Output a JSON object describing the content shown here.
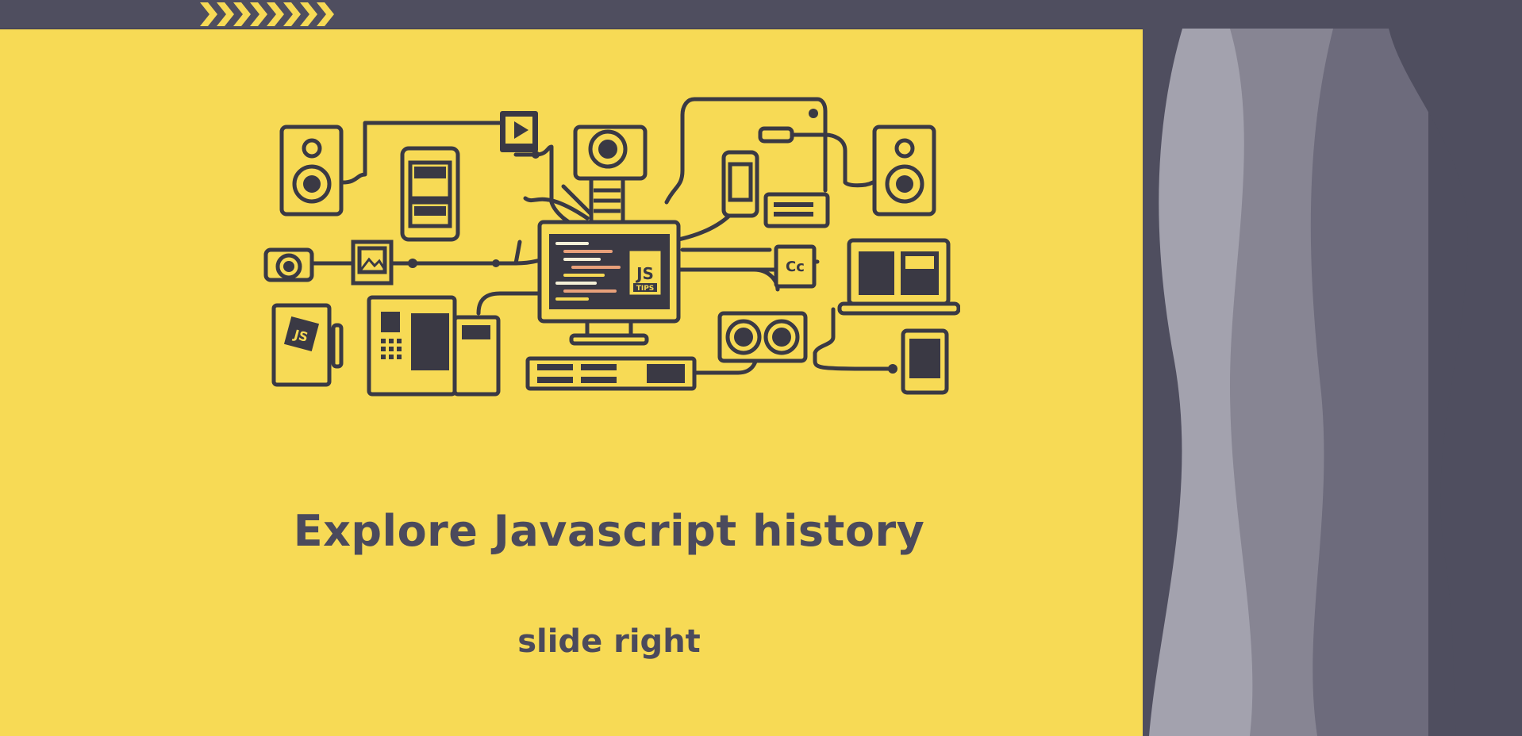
{
  "colors": {
    "background": "#f7da55",
    "ink": "#3a3944",
    "title": "#4b4a5c",
    "topbar": "#4f4e5f",
    "curtain_light": "#a3a2ae",
    "curtain_mid": "#878593",
    "curtain_dark": "#6d6b7c",
    "curtain_darkest": "#4f4e5f"
  },
  "icons": {
    "progress": "chevron-progress-icon",
    "badge": "js-tips-badge",
    "caption": "closed-captions-icon"
  },
  "illustration": {
    "badge_main": "JS",
    "badge_sub": "TIPS",
    "notebook_label": "JS",
    "cc_label": "Cc"
  },
  "main": {
    "title": "Explore Javascript history",
    "hint": "slide right"
  }
}
